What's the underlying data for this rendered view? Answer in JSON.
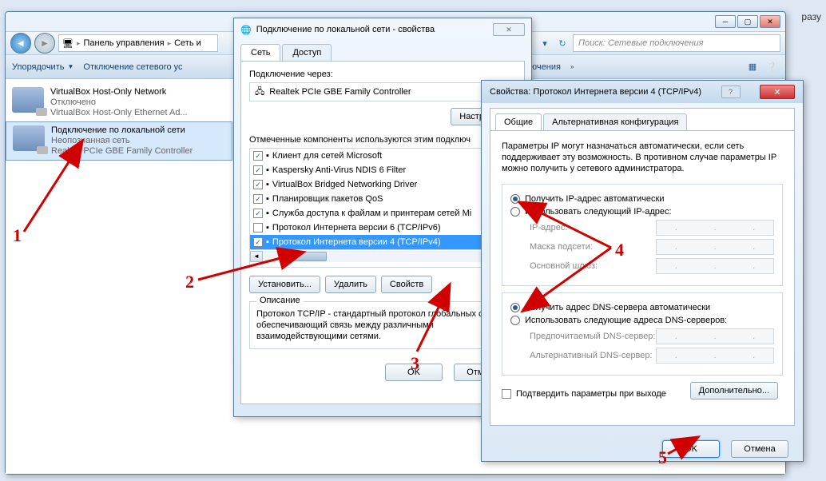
{
  "side_text": "разу",
  "main_window": {
    "nav": {
      "breadcrumb1": "Панель управления",
      "breadcrumb2": "Сеть и",
      "search_placeholder": "Поиск: Сетевые подключения"
    },
    "toolbar": {
      "organize": "Упорядочить",
      "disable": "Отключение сетевого ус",
      "connections_word": "ключения",
      "chev": "»"
    },
    "connections": [
      {
        "title": "VirtualBox Host-Only Network",
        "status": "Отключено",
        "adapter": "VirtualBox Host-Only Ethernet Ad..."
      },
      {
        "title": "Подключение по локальной сети",
        "status": "Неопознанная сеть",
        "adapter": "Realtek PCIe GBE Family Controller"
      }
    ]
  },
  "dialog1": {
    "title": "Подключение по локальной сети - свойства",
    "tabs": {
      "network": "Сеть",
      "access": "Доступ"
    },
    "connect_via_label": "Подключение через:",
    "adapter": "Realtek PCIe GBE Family Controller",
    "configure_btn": "Настроить",
    "components_label": "Отмеченные компоненты используются этим подключ",
    "components": [
      {
        "checked": true,
        "name": "Клиент для сетей Microsoft"
      },
      {
        "checked": true,
        "name": "Kaspersky Anti-Virus NDIS 6 Filter"
      },
      {
        "checked": true,
        "name": "VirtualBox Bridged Networking Driver"
      },
      {
        "checked": true,
        "name": "Планировщик пакетов QoS"
      },
      {
        "checked": true,
        "name": "Служба доступа к файлам и принтерам сетей Mi"
      },
      {
        "checked": false,
        "name": "Протокол Интернета версии 6 (TCP/IPv6)"
      },
      {
        "checked": true,
        "name": "Протокол Интернета версии 4 (TCP/IPv4)",
        "sel": true
      }
    ],
    "install_btn": "Установить...",
    "remove_btn": "Удалить",
    "props_btn": "Свойств",
    "desc_title": "Описание",
    "desc_text": "Протокол TCP/IP - стандартный протокол глобальных сетей, обеспечивающий связь между различными взаимодействующими сетями.",
    "ok": "OK",
    "cancel": "Отмена"
  },
  "dialog2": {
    "title": "Свойства: Протокол Интернета версии 4 (TCP/IPv4)",
    "tabs": {
      "general": "Общие",
      "alt": "Альтернативная конфигурация"
    },
    "desc": "Параметры IP могут назначаться автоматически, если сеть поддерживает эту возможность. В противном случае параметры IP можно получить у сетевого администратора.",
    "radio_auto_ip": "Получить IP-адрес автоматически",
    "radio_manual_ip": "Использовать следующий IP-адрес:",
    "ip_label": "IP-адрес:",
    "mask_label": "Маска подсети:",
    "gateway_label": "Основной шлюз:",
    "radio_auto_dns": "Получить адрес DNS-сервера автоматически",
    "radio_manual_dns": "Использовать следующие адреса DNS-серверов:",
    "dns1_label": "Предпочитаемый DNS-сервер:",
    "dns2_label": "Альтернативный DNS-сервер:",
    "confirm_check": "Подтвердить параметры при выходе",
    "advanced_btn": "Дополнительно...",
    "ok": "OK",
    "cancel": "Отмена"
  },
  "markers": {
    "m1": "1",
    "m2": "2",
    "m3": "3",
    "m4": "4",
    "m5": "5"
  }
}
